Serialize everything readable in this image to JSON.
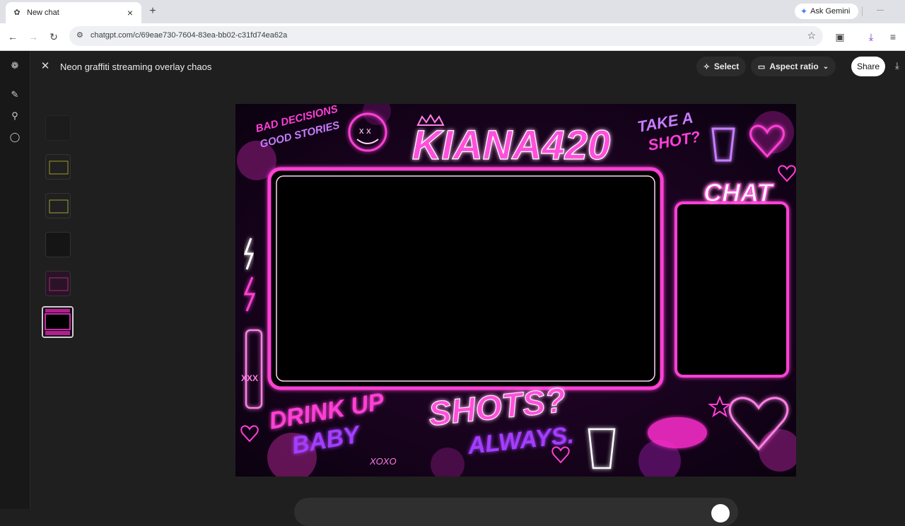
{
  "browser": {
    "tab_title": "New chat",
    "tab_favicon": "chatgpt-icon",
    "new_tab_label": "+",
    "ask_gemini_label": "Ask Gemini",
    "url": "chatgpt.com/c/69eae730-7604-83ea-bb02-c31fd74ea62a"
  },
  "header": {
    "title": "Neon graffiti streaming overlay chaos",
    "select_label": "Select",
    "aspect_ratio_label": "Aspect ratio",
    "share_label": "Share"
  },
  "rail_icons": [
    "openai-logo-icon",
    "new-chat-icon",
    "search-icon",
    "chat-bubble-icon"
  ],
  "thumbnails": 6,
  "image": {
    "title": "KIANA420",
    "top_left_text": "BAD DECISIONS",
    "top_left_text2": "GOOD STORIES",
    "take_a_shot": "TAKE A",
    "take_a_shot2": "SHOT?",
    "chat_label": "CHAT",
    "drink_up": "DRINK UP",
    "baby": "BABY",
    "xoxo": "XOXO",
    "shots": "SHOTS?",
    "always": "ALWAYS.",
    "xxx": "XXX"
  },
  "colors": {
    "neon_pink": "#ff2fd0",
    "neon_purple": "#a43cff",
    "page_bg": "#1f1f1f",
    "chrome_bg": "#dfe1e6"
  }
}
